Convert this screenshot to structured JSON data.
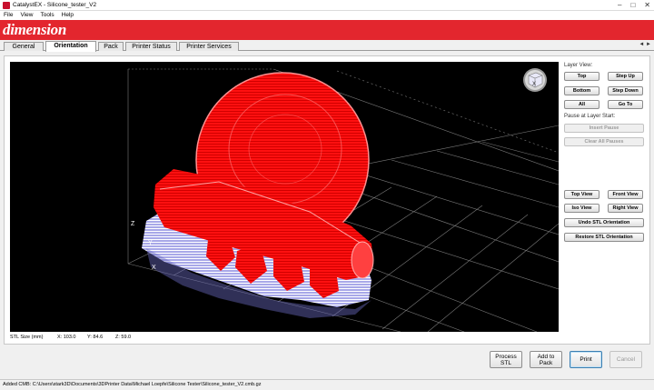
{
  "window": {
    "title": "CatalystEX - Silicone_tester_V2",
    "minimize_glyph": "–",
    "maximize_glyph": "□",
    "close_glyph": "✕"
  },
  "menu": {
    "items": [
      "File",
      "View",
      "Tools",
      "Help"
    ]
  },
  "brand": {
    "logo_text": "dimension"
  },
  "tabs": {
    "items": [
      "General",
      "Orientation",
      "Pack",
      "Printer Status",
      "Printer Services"
    ],
    "active": "Orientation",
    "scroll_left": "◄",
    "scroll_right": "►"
  },
  "viewport": {
    "axis_labels": {
      "z": "Z",
      "y": "Y",
      "x": "X"
    },
    "view_cube_label": "X",
    "model_color": "#ff0000",
    "support_color": "#b8b8f0",
    "background": "#000000"
  },
  "side_panel": {
    "layer_view_label": "Layer View:",
    "top": "Top",
    "step_up": "Step Up",
    "bottom": "Bottom",
    "step_down": "Step Down",
    "all": "All",
    "go_to": "Go To",
    "pause_label": "Pause at Layer Start:",
    "insert_pause": "Insert Pause",
    "clear_all_pauses": "Clear All Pauses",
    "top_view": "Top View",
    "front_view": "Front View",
    "iso_view": "Iso View",
    "right_view": "Right View",
    "undo_stl_orientation": "Undo STL Orientation",
    "restore_stl_orientation": "Restore STL Orientation"
  },
  "stl_info": {
    "label": "STL Size (mm)",
    "x": "X:  103.0",
    "y": "Y:  84.6",
    "z": "Z:  59.0"
  },
  "actions": {
    "process_stl_line1": "Process",
    "process_stl_line2": "STL",
    "add_to_pack_line1": "Add to",
    "add_to_pack_line2": "Pack",
    "print": "Print",
    "cancel": "Cancel"
  },
  "status": {
    "text": "Added CMB:  C:\\Users\\stark3D\\Documents\\3DPrinter Data\\Michael Loepfe\\Silicone Tester\\Silicone_tester_V2.cmb.gz"
  }
}
